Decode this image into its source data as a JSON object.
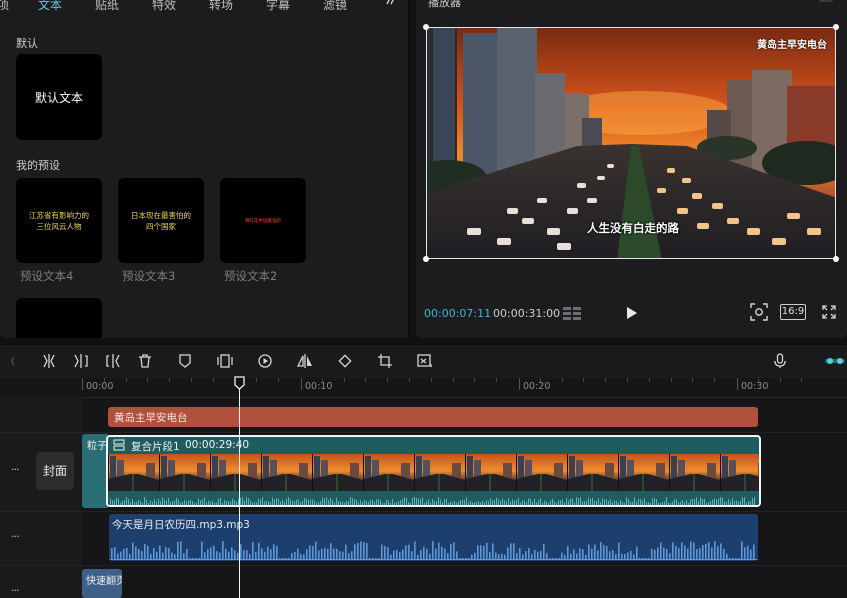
{
  "tabs": [
    {
      "label": "项",
      "active": false
    },
    {
      "label": "文本",
      "active": true
    },
    {
      "label": "贴纸",
      "active": false
    },
    {
      "label": "特效",
      "active": false
    },
    {
      "label": "转场",
      "active": false
    },
    {
      "label": "字幕",
      "active": false
    },
    {
      "label": "滤镜",
      "active": false
    }
  ],
  "left_panel": {
    "default_section": "默认",
    "default_card_text": "默认文本",
    "my_presets_section": "我的预设",
    "presets": [
      {
        "card_text": "江苏省有影响力的\n三位风云人物",
        "label": "预设文本4"
      },
      {
        "card_text": "日本现在最害怕的\n四个国家",
        "label": "预设文本3"
      },
      {
        "card_text": "哪吒是中国最强的",
        "label": "预设文本2"
      }
    ]
  },
  "player": {
    "title": "播放器",
    "video_caption": "人生没有白走的路",
    "video_watermark": "黄岛主早安电台",
    "current_time": "00:00:07:11",
    "total_time": "00:00:31:00",
    "ratio": "16:9"
  },
  "timeline": {
    "ruler_labels": [
      "00:00",
      "00:10",
      "00:20",
      "00:30"
    ],
    "cover_label": "封面",
    "track_more": "···",
    "text_clip": "黄岛主早安电台",
    "particle_clip": "粒子",
    "compound_clip_title": "复合片段1",
    "compound_clip_duration": "00:00:29:40",
    "audio_clip": "今天是月日农历四.mp3.mp3",
    "fast_clip": "快速翻页"
  },
  "colors": {
    "accent": "#5ad0d8",
    "time_current": "#3fb4d2",
    "text_clip": "#b0513d",
    "video_clip": "#1f5b5f",
    "audio_clip": "#1d3f6e"
  }
}
